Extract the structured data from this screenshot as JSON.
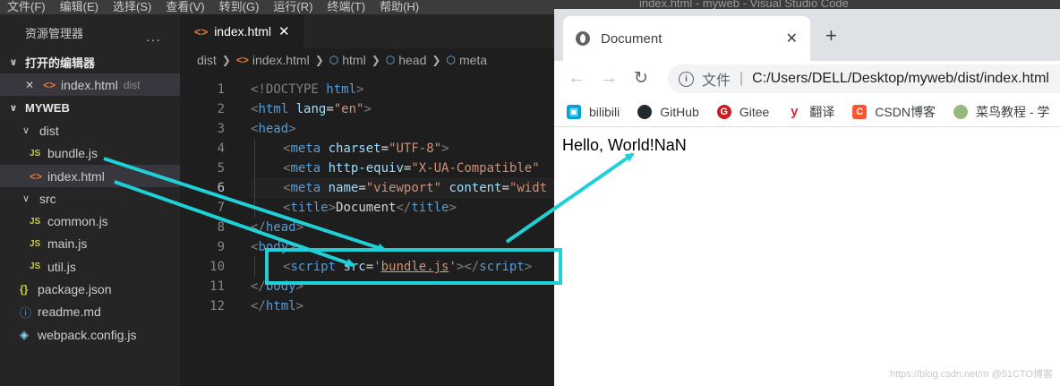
{
  "menubar": {
    "items": [
      "文件(F)",
      "编辑(E)",
      "选择(S)",
      "查看(V)",
      "转到(G)",
      "运行(R)",
      "终端(T)",
      "帮助(H)"
    ],
    "window_title": "index.html - myweb - Visual Studio Code"
  },
  "sidebar": {
    "title": "资源管理器",
    "more": "···",
    "open_editors": {
      "label": "打开的编辑器",
      "items": [
        {
          "close": "✕",
          "name": "index.html",
          "folder": "dist"
        }
      ]
    },
    "project": {
      "label": "MYWEB",
      "tree": [
        {
          "name": "dist",
          "kind": "folder"
        },
        {
          "name": "bundle.js",
          "kind": "js"
        },
        {
          "name": "index.html",
          "kind": "html"
        },
        {
          "name": "src",
          "kind": "folder"
        },
        {
          "name": "common.js",
          "kind": "js"
        },
        {
          "name": "main.js",
          "kind": "js"
        },
        {
          "name": "util.js",
          "kind": "js"
        },
        {
          "name": "package.json",
          "kind": "json"
        },
        {
          "name": "readme.md",
          "kind": "md"
        },
        {
          "name": "webpack.config.js",
          "kind": "webpack"
        }
      ]
    }
  },
  "editor": {
    "tab": {
      "label": "index.html",
      "close": "✕"
    },
    "breadcrumb": [
      "dist",
      "index.html",
      "html",
      "head",
      "meta"
    ],
    "current_line": 6,
    "line_numbers": [
      "1",
      "2",
      "3",
      "4",
      "5",
      "6",
      "7",
      "8",
      "9",
      "10",
      "11",
      "12"
    ],
    "code": {
      "l1": [
        "<!DOCTYPE",
        " ",
        "html",
        ">"
      ],
      "l2": [
        "<",
        "html",
        " ",
        "lang",
        "=",
        "\"en\"",
        ">"
      ],
      "l3": [
        "<",
        "head",
        ">"
      ],
      "l4": [
        "<",
        "meta",
        " ",
        "charset",
        "=",
        "\"UTF-8\"",
        ">"
      ],
      "l5": [
        "<",
        "meta",
        " ",
        "http-equiv",
        "=",
        "\"X-UA-Compatible\""
      ],
      "l6": [
        "<",
        "meta",
        " ",
        "name",
        "=",
        "\"viewport\"",
        " ",
        "content",
        "=",
        "\"widt"
      ],
      "l7": [
        "<",
        "title",
        ">",
        "Document",
        "</",
        "title",
        ">"
      ],
      "l8": [
        "</",
        "head",
        ">"
      ],
      "l9": [
        "<",
        "body",
        ">"
      ],
      "l10": [
        "<",
        "script",
        " ",
        "src",
        "=",
        "'",
        "bundle.js",
        "'",
        "></",
        "script",
        ">"
      ],
      "l11": [
        "</",
        "body",
        ">"
      ],
      "l12": [
        "</",
        "html",
        ">"
      ]
    }
  },
  "browser": {
    "tab_title": "Document",
    "tab_close": "✕",
    "new_tab": "+",
    "nav": {
      "back": "←",
      "forward": "→",
      "reload": "↻"
    },
    "omnibox": {
      "scheme_label": "文件",
      "separator": "|",
      "url": "C:/Users/DELL/Desktop/myweb/dist/index.html"
    },
    "bookmarks": [
      {
        "label": "bilibili",
        "icon": "bilibili-icon",
        "color": "#00a1d6",
        "glyph": "▣"
      },
      {
        "label": "GitHub",
        "icon": "github-icon",
        "color": "#24292e",
        "glyph": "●"
      },
      {
        "label": "Gitee",
        "icon": "gitee-icon",
        "color": "#c71d23",
        "glyph": "G"
      },
      {
        "label": "翻译",
        "icon": "youdao-icon",
        "color": "#e5283a",
        "glyph": "y"
      },
      {
        "label": "CSDN博客",
        "icon": "csdn-icon",
        "color": "#fc5531",
        "glyph": "C"
      },
      {
        "label": "菜鸟教程 - 学",
        "icon": "runoob-icon",
        "color": "#96b97d",
        "glyph": "●"
      }
    ],
    "page_text": "Hello, World!NaN",
    "watermark": "https://blog.csdn.net/m @51CTO博客"
  },
  "annotation": {
    "arrow_color": "#1fd0d6"
  }
}
